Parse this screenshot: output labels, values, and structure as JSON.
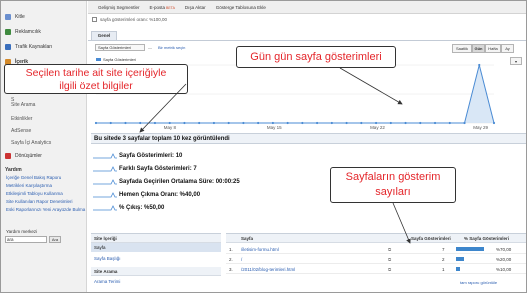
{
  "sidebar": {
    "items": [
      {
        "label": "Kitle",
        "icon": "people-icon",
        "color": "#6a8fcf"
      },
      {
        "label": "Reklamcılık",
        "icon": "ads-icon",
        "color": "#3f8a3f"
      },
      {
        "label": "Trafik Kaynakları",
        "icon": "traffic-icon",
        "color": "#3a6fbd"
      },
      {
        "label": "İçerik",
        "icon": "content-icon",
        "color": "#d48a2a"
      }
    ],
    "sub_items": [
      "S",
      "S",
      "S",
      "Site Arama",
      "Etkinlikler",
      "AdSense",
      "Sayfa İçi Analytics"
    ],
    "conversions": {
      "label": "Dönüşümler",
      "color": "#cc3333"
    },
    "help": {
      "title": "Yardım",
      "links": [
        "İçeriğe Genel Bakış Raporu",
        "Metrikleri Karşılaştırma",
        "Etkileşimli Tabloyu Kullanma",
        "Site Kullanıları Rapor Denetimleri",
        "Eski Raporlarınızı Yeni Arayüzde Bulma"
      ],
      "search_title": "Yardım merkezi",
      "search_value": "ara",
      "search_button": "Ara"
    }
  },
  "toolbar": {
    "items": [
      "Gelişmiş Segmentler",
      "E-posta",
      "Dışa Aktar",
      "Gösterge Tablosuna Ekle"
    ],
    "email_badge": "BETA"
  },
  "page": {
    "title": "sayfa gösterimleri oranı: %100,00",
    "tab": "Genel Bakış"
  },
  "graph_controls": {
    "metric_select": "Sayfa Gösterimleri",
    "vs": "—",
    "compare_link": "Bir metrik seçin",
    "periods": [
      "Saatlik",
      "Gün",
      "Hafta",
      "Ay"
    ],
    "active_period": "Gün",
    "legend": "Sayfa Gösterimleri"
  },
  "chart_data": {
    "type": "line",
    "x_labels": [
      "May 8",
      "May 15",
      "May 22",
      "May 29"
    ],
    "values": [
      0,
      0,
      0,
      0,
      0,
      0,
      0,
      0,
      0,
      0,
      0,
      0,
      0,
      0,
      0,
      0,
      0,
      0,
      0,
      0,
      0,
      0,
      0,
      0,
      0,
      0,
      10,
      0
    ],
    "y_label": "5",
    "color": "#4a8bd4"
  },
  "summary": {
    "heading": "Bu sitede 3 sayfalar toplam 10 kez görüntülendi",
    "metrics": [
      "Sayfa Gösterimleri: 10",
      "Farklı Sayfa Gösterimleri: 7",
      "Sayfada Geçirilen Ortalama Süre: 00:00:25",
      "Hemen Çıkma Oranı: %40,00",
      "% Çıkış: %50,00"
    ]
  },
  "left_table": {
    "sections": [
      {
        "heading": "Site İçeriği",
        "rows": [
          "Sayfa",
          "Sayfa Başlığı"
        ]
      },
      {
        "heading": "Site Arama",
        "rows": [
          "Arama Terimi"
        ]
      }
    ]
  },
  "right_table": {
    "headers": [
      "Sayfa",
      "Sayfa Gösterimleri",
      "% Sayfa Gösterimleri"
    ],
    "rows": [
      {
        "num": "1.",
        "page": "/iletisim-formu.html",
        "views": "7",
        "pct": "%70,00",
        "share": 0.7
      },
      {
        "num": "2.",
        "page": "/",
        "views": "2",
        "pct": "%20,00",
        "share": 0.2
      },
      {
        "num": "3.",
        "page": "/2011/02/blog-terimleri.html",
        "views": "1",
        "pct": "%10,00",
        "share": 0.1
      }
    ],
    "report_link": "tam raporu görüntüle"
  },
  "annotations": {
    "top": "Gün gün sayfa gösterimleri",
    "left_line1": "Seçilen tarihe ait site içeriğiyle",
    "left_line2": "ilgili özet bilgiler",
    "bottom_line1": "Sayfaların gösterim",
    "bottom_line2": "sayıları",
    "text_color": "#e4262b"
  }
}
